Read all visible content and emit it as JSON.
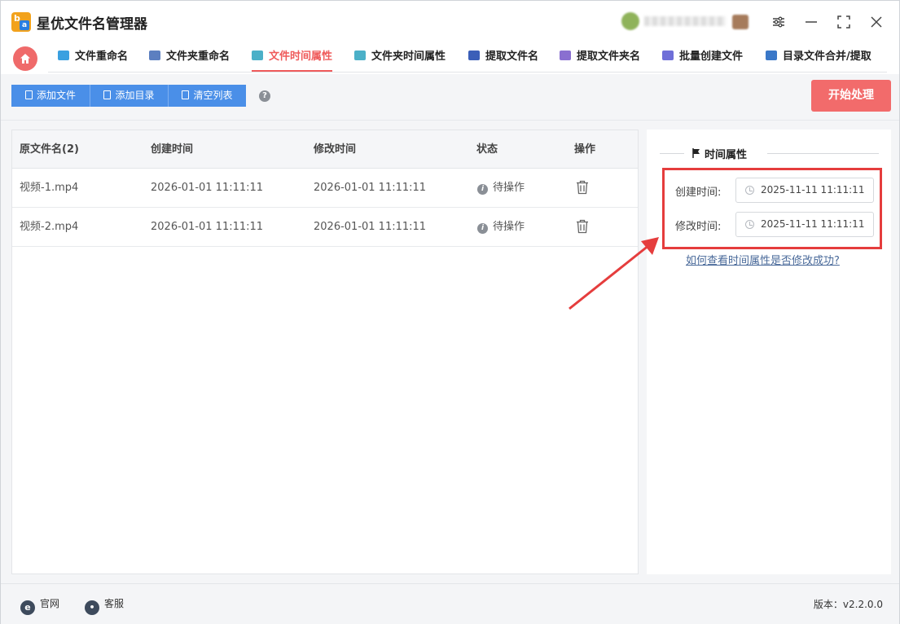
{
  "app": {
    "title": "星优文件名管理器"
  },
  "tabs": [
    {
      "label": "文件重命名",
      "color": "#3aa0e0"
    },
    {
      "label": "文件夹重命名",
      "color": "#5c7fc0"
    },
    {
      "label": "文件时间属性",
      "color": "#4bb0c8",
      "active": true
    },
    {
      "label": "文件夹时间属性",
      "color": "#4bb0c8"
    },
    {
      "label": "提取文件名",
      "color": "#3b5fb8"
    },
    {
      "label": "提取文件夹名",
      "color": "#8a6fd0"
    },
    {
      "label": "批量创建文件",
      "color": "#6f6fd8"
    },
    {
      "label": "目录文件合并/提取",
      "color": "#3a78c8"
    }
  ],
  "toolbar": {
    "add_file": "添加文件",
    "add_dir": "添加目录",
    "clear_list": "清空列表",
    "start": "开始处理"
  },
  "table": {
    "headers": [
      "原文件名(2)",
      "创建时间",
      "修改时间",
      "状态",
      "操作"
    ],
    "rows": [
      {
        "name": "视频-1.mp4",
        "created": "2026-01-01 11:11:11",
        "modified": "2026-01-01 11:11:11",
        "status": "待操作"
      },
      {
        "name": "视频-2.mp4",
        "created": "2026-01-01 11:11:11",
        "modified": "2026-01-01 11:11:11",
        "status": "待操作"
      }
    ]
  },
  "panel": {
    "title": "时间属性",
    "create_label": "创建时间:",
    "create_value": "2025-11-11 11:11:11",
    "modify_label": "修改时间:",
    "modify_value": "2025-11-11 11:11:11",
    "help_link": "如何查看时间属性是否修改成功?"
  },
  "footer": {
    "website": "官网",
    "support": "客服",
    "version": "版本：v2.2.0.0"
  },
  "colors": {
    "accent": "#ef5b5b",
    "primary": "#4a8fe8",
    "highlight": "#e53d3d"
  }
}
